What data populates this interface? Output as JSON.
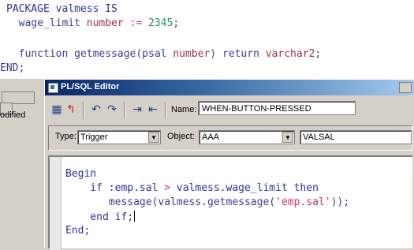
{
  "background_editor": {
    "line1": [
      "PACKAGE valmess IS"
    ],
    "line2": [
      "  wage_limit ",
      "number",
      " := ",
      "2345",
      ";"
    ],
    "line3": [
      "  function getmessage(psal ",
      "number",
      ") return ",
      "varchar2",
      ";"
    ],
    "line4": "END;"
  },
  "left_panel": {
    "label": "odified"
  },
  "window": {
    "title": "PL/SQL Editor"
  },
  "toolbar": {
    "name_label": "Name:",
    "name_value": "WHEN-BUTTON-PRESSED",
    "icons": [
      "compile-icon",
      "revert-icon",
      "undo-icon",
      "redo-icon",
      "indent-icon",
      "outdent-icon"
    ]
  },
  "selectors": {
    "type_label": "Type:",
    "type_value": "Trigger",
    "object_label": "Object:",
    "object_value": "AAA",
    "item_value": "VALSAL"
  },
  "code": {
    "l1": "Begin",
    "l2a": "    if :emp.sal ",
    "l2b": ">",
    "l2c": " valmess.wage_limit then",
    "l3a": "       message(valmess.getmessage(",
    "l3b": "'emp.sal'",
    "l3c": "));",
    "l4": "    end if;",
    "l5": "End;"
  }
}
